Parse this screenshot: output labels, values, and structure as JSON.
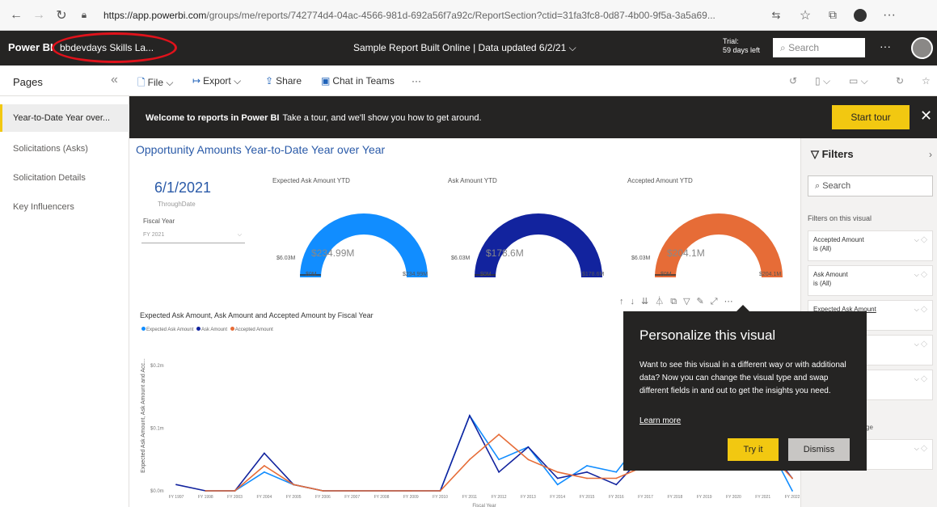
{
  "browser": {
    "url_host": "https://app.powerbi.com",
    "url_rest": "/groups/me/reports/742774d4-04ac-4566-981d-692a56f7a92c/ReportSection?ctid=31fa3fc8-0d87-4b00-9f5a-3a5a69..."
  },
  "header": {
    "logo": "Power BI",
    "workspace": "bbdevdays Skills La...",
    "report_name": "Sample Report Built Online  |  Data updated 6/2/21  ⌵",
    "trial_line1": "Trial:",
    "trial_line2": "59 days left",
    "search_placeholder": "Search",
    "more": "···"
  },
  "toolbar": {
    "pages_title": "Pages",
    "file": "File",
    "export": "Export",
    "share": "Share",
    "chat": "Chat in Teams",
    "more": "···"
  },
  "pages": [
    {
      "label": "Year-to-Date Year over..."
    },
    {
      "label": "Solicitations (Asks)"
    },
    {
      "label": "Solicitation Details"
    },
    {
      "label": "Key Influencers"
    }
  ],
  "banner": {
    "bold": "Welcome to reports in Power BI",
    "text": "Take a tour, and we'll show you how to get around.",
    "button": "Start tour",
    "close": "✕"
  },
  "report": {
    "title": "Opportunity Amounts Year-to-Date Year over Year",
    "date": "6/1/2021",
    "through": "ThroughDate",
    "fy_label": "Fiscal Year",
    "fy_value": "FY 2021"
  },
  "gauges": [
    {
      "title": "Expected Ask Amount YTD",
      "value_label": "$234.99M",
      "min": "$0M",
      "max": "$234.99M",
      "target": "$6.03M",
      "value": 234.99,
      "max_value": 234.99,
      "color": "#118dff"
    },
    {
      "title": "Ask Amount YTD",
      "value_label": "$178.6M",
      "min": "$0M",
      "max": "$178.6M",
      "target": "$6.03M",
      "value": 178.6,
      "max_value": 178.6,
      "color": "#12239e"
    },
    {
      "title": "Accepted Amount YTD",
      "value_label": "$204.1M",
      "min": "$0M",
      "max": "$204.1M",
      "target": "$6.03M",
      "value": 204.1,
      "max_value": 204.1,
      "color": "#e66c37"
    }
  ],
  "chart_data": {
    "type": "line",
    "title": "Expected Ask Amount, Ask Amount and Accepted Amount by Fiscal Year",
    "ylabel": "Expected Ask Amount, Ask Amount and Acc...",
    "xlabel": "Fiscal Year",
    "ylim": [
      0,
      0.24
    ],
    "yticks": [
      "$0.0m",
      "$0.1m",
      "$0.2m"
    ],
    "categories": [
      "FY 1997",
      "FY 1998",
      "FY 2003",
      "FY 2004",
      "FY 2005",
      "FY 2006",
      "FY 2007",
      "FY 2008",
      "FY 2009",
      "FY 2010",
      "FY 2011",
      "FY 2012",
      "FY 2013",
      "FY 2014",
      "FY 2015",
      "FY 2016",
      "FY 2017",
      "FY 2018",
      "FY 2019",
      "FY 2020",
      "FY 2021",
      "FY 2022"
    ],
    "series": [
      {
        "name": "Expected Ask Amount",
        "color": "#118dff",
        "values": [
          null,
          0,
          0,
          0.03,
          0.01,
          0,
          0,
          0,
          0,
          0,
          0.12,
          0.05,
          0.07,
          0.01,
          0.04,
          0.03,
          0.09,
          0.13,
          0.12,
          0.06,
          0.09,
          0
        ]
      },
      {
        "name": "Ask Amount",
        "color": "#12239e",
        "values": [
          0.01,
          0,
          0,
          0.06,
          0.01,
          0,
          0,
          0,
          0,
          0,
          0.12,
          0.03,
          0.07,
          0.02,
          0.03,
          0.01,
          0.06,
          0.1,
          0.11,
          0.05,
          0.08,
          0.02
        ]
      },
      {
        "name": "Accepted Amount",
        "color": "#e66c37",
        "values": [
          null,
          0,
          0,
          0.04,
          0.01,
          0,
          0,
          0,
          0,
          0,
          0.05,
          0.09,
          0.05,
          0.03,
          0.02,
          0.02,
          0.04,
          0.08,
          0.09,
          0.05,
          0.07,
          0.02
        ]
      }
    ]
  },
  "filters": {
    "title": "Filters",
    "search": "Search",
    "on_visual": "Filters on this visual",
    "cards": [
      {
        "name": "Accepted Amount",
        "state": "is (All)"
      },
      {
        "name": "Ask Amount",
        "state": "is (All)"
      },
      {
        "name": "Expected Ask Amount",
        "state": ""
      },
      {
        "name": "",
        "state": ""
      },
      {
        "name": "",
        "state": ""
      }
    ],
    "partial_label": "ge"
  },
  "popup": {
    "title": "Personalize this visual",
    "body": "Want to see this visual in a different way or with additional data? Now you can change the visual type and swap different fields in and out to get the insights you need.",
    "link": "Learn more",
    "try": "Try it",
    "dismiss": "Dismiss"
  }
}
